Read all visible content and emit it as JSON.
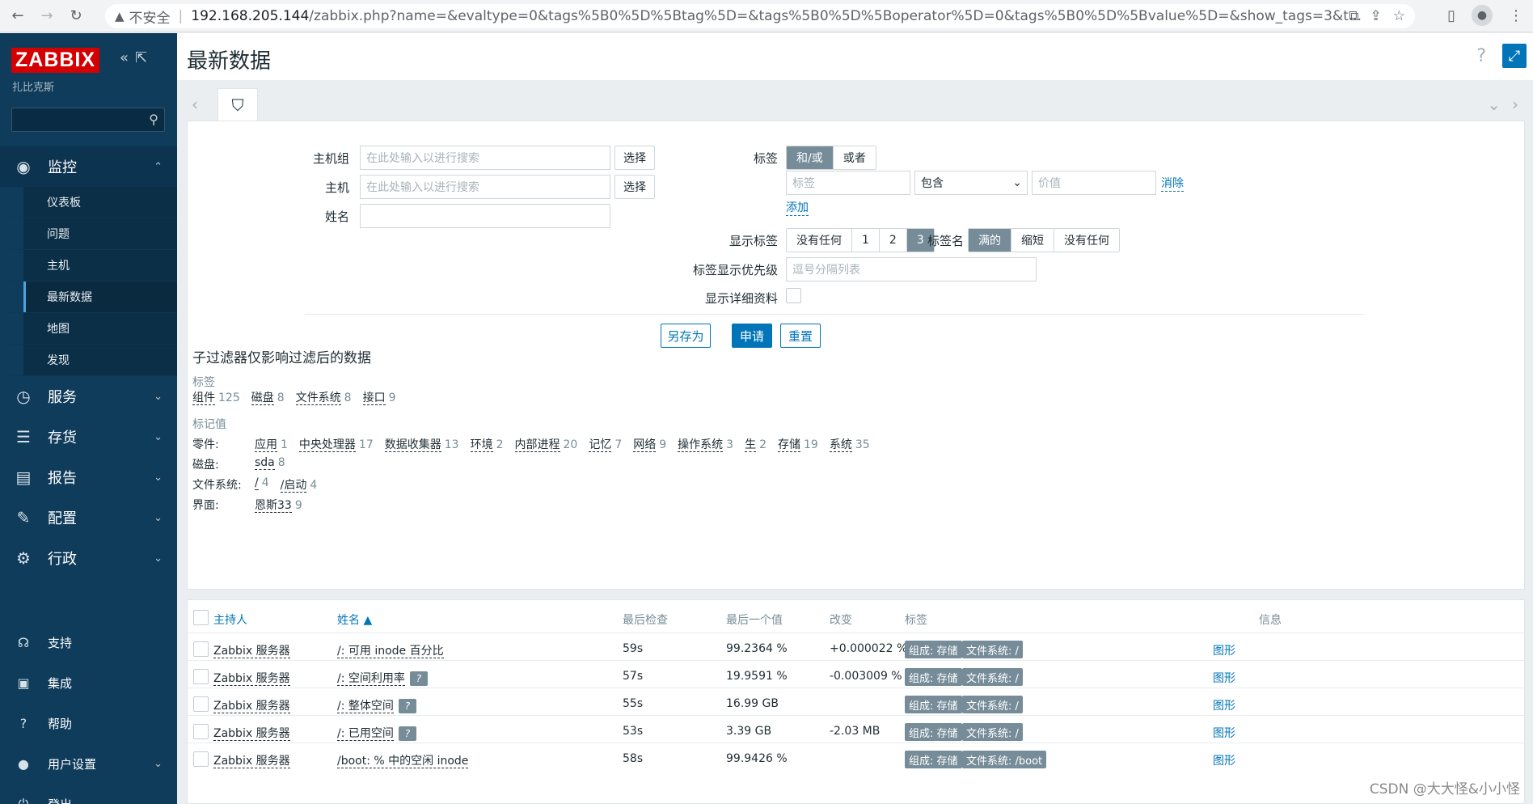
{
  "browser": {
    "insecure_label": "不安全",
    "url_host": "192.168.205.144",
    "url_path": "/zabbix.php?name=&evaltype=0&tags%5B0%5D%5Btag%5D=&tags%5B0%5D%5Boperator%5D=0&tags%5B0%5D%5Bvalue%5D=&show_tags=3&t..."
  },
  "sidebar": {
    "logo": "ZABBIX",
    "subtitle": "扎比克斯",
    "menu": [
      {
        "label": "监控",
        "icon": "eye-icon"
      },
      {
        "label": "服务",
        "icon": "clock-icon"
      },
      {
        "label": "存货",
        "icon": "list-icon"
      },
      {
        "label": "报告",
        "icon": "bar-chart-icon"
      },
      {
        "label": "配置",
        "icon": "wrench-icon"
      },
      {
        "label": "行政",
        "icon": "gear-icon"
      }
    ],
    "submenu": [
      "仪表板",
      "问题",
      "主机",
      "最新数据",
      "地图",
      "发现"
    ],
    "lower": [
      {
        "label": "支持",
        "icon": "headset-icon"
      },
      {
        "label": "集成",
        "icon": "integration-icon"
      },
      {
        "label": "帮助",
        "icon": "help-icon"
      },
      {
        "label": "用户设置",
        "icon": "user-icon"
      },
      {
        "label": "登出",
        "icon": "power-icon"
      }
    ]
  },
  "page": {
    "title": "最新数据"
  },
  "filter": {
    "host_group_label": "主机组",
    "host_label": "主机",
    "name_label": "姓名",
    "search_placeholder": "在此处输入以进行搜索",
    "select_label": "选择",
    "tags_label": "标签",
    "tags_and_or": "和/或",
    "tags_or": "或者",
    "tag_placeholder": "标签",
    "tag_operator": "包含",
    "value_placeholder": "价值",
    "remove_label": "消除",
    "add_label": "添加",
    "show_tags_label": "显示标签",
    "show_tags_options": [
      "没有任何",
      "1",
      "2",
      "3"
    ],
    "tag_name_label": "标签名",
    "tag_name_options": [
      "满的",
      "缩短",
      "没有任何"
    ],
    "tag_priority_label": "标签显示优先级",
    "tag_priority_placeholder": "逗号分隔列表",
    "show_details_label": "显示详细资料",
    "save_as": "另存为",
    "apply": "申请",
    "reset": "重置"
  },
  "subfilter": {
    "title": "子过滤器仅影响过滤后的数据",
    "tags_heading": "标签",
    "tags": [
      {
        "name": "组件",
        "count": "125"
      },
      {
        "name": "磁盘",
        "count": "8"
      },
      {
        "name": "文件系统",
        "count": "8"
      },
      {
        "name": "接口",
        "count": "9"
      }
    ],
    "values_heading": "标记值",
    "rows": [
      {
        "label": "零件:",
        "values": [
          {
            "name": "应用",
            "count": "1"
          },
          {
            "name": "中央处理器",
            "count": "17"
          },
          {
            "name": "数据收集器",
            "count": "13"
          },
          {
            "name": "环境",
            "count": "2"
          },
          {
            "name": "内部进程",
            "count": "20"
          },
          {
            "name": "记忆",
            "count": "7"
          },
          {
            "name": "网络",
            "count": "9"
          },
          {
            "name": "操作系统",
            "count": "3"
          },
          {
            "name": "生",
            "count": "2"
          },
          {
            "name": "存储",
            "count": "19"
          },
          {
            "name": "系统",
            "count": "35"
          }
        ]
      },
      {
        "label": "磁盘:",
        "values": [
          {
            "name": "sda",
            "count": "8"
          }
        ]
      },
      {
        "label": "文件系统:",
        "values": [
          {
            "name": "/",
            "count": "4"
          },
          {
            "name": "/启动",
            "count": "4"
          }
        ]
      },
      {
        "label": "界面:",
        "values": [
          {
            "name": "恩斯33",
            "count": "9"
          }
        ]
      }
    ]
  },
  "table": {
    "headers": {
      "host": "主持人",
      "name": "姓名 ▲",
      "last_check": "最后检查",
      "last_value": "最后一个值",
      "change": "改变",
      "tags": "标签",
      "info": "信息"
    },
    "rows": [
      {
        "host": "Zabbix 服务器",
        "name": "/: 可用 inode 百分比",
        "help": false,
        "last_check": "59s",
        "last_value": "99.2364 %",
        "change": "+0.000022 %",
        "tag1": "组成: 存储",
        "tag2": "文件系统: /",
        "graph": "图形"
      },
      {
        "host": "Zabbix 服务器",
        "name": "/:  空间利用率",
        "help": true,
        "last_check": "57s",
        "last_value": "19.9591 %",
        "change": "-0.003009 %",
        "tag1": "组成: 存储",
        "tag2": "文件系统: /",
        "graph": "图形"
      },
      {
        "host": "Zabbix 服务器",
        "name": "/:  整体空间",
        "help": true,
        "last_check": "55s",
        "last_value": "16.99 GB",
        "change": "",
        "tag1": "组成: 存储",
        "tag2": "文件系统: /",
        "graph": "图形"
      },
      {
        "host": "Zabbix 服务器",
        "name": "/:  已用空间",
        "help": true,
        "last_check": "53s",
        "last_value": "3.39 GB",
        "change": "-2.03 MB",
        "tag1": "组成: 存储",
        "tag2": "文件系统: /",
        "graph": "图形"
      },
      {
        "host": "Zabbix 服务器",
        "name": "/boot: % 中的空闲 inode",
        "help": false,
        "last_check": "58s",
        "last_value": "99.9426 %",
        "change": "",
        "tag1": "组成: 存储",
        "tag2": "文件系统: /boot",
        "graph": "图形"
      }
    ]
  },
  "watermark": "CSDN @大大怪&小小怪",
  "colors": {
    "sidebar": "#0f3c5b",
    "accent": "#0275b8",
    "logo": "#d40000",
    "badge": "#768d99"
  }
}
